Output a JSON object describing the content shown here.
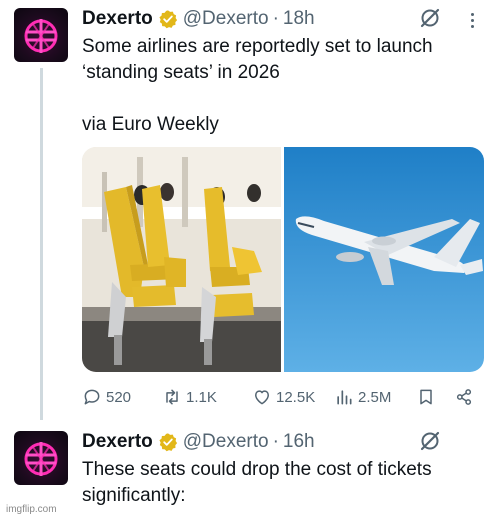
{
  "colors": {
    "text_primary": "#0f1419",
    "text_secondary": "#536471",
    "thread_line": "#cfd9de",
    "verified_badge": "#e2b719",
    "avatar_glow": "#ff2db4"
  },
  "tweets": [
    {
      "author_name": "Dexerto",
      "handle": "@Dexerto",
      "separator": "·",
      "time": "18h",
      "text_lines": [
        "Some airlines are reportedly set to launch",
        "‘standing seats’ in 2026",
        "via Euro Weekly"
      ],
      "media": [
        {
          "icon": "standing-seats-photo"
        },
        {
          "icon": "airplane-photo"
        }
      ],
      "actions": {
        "replies": "520",
        "reposts": "1.1K",
        "likes": "12.5K",
        "views": "2.5M"
      }
    },
    {
      "author_name": "Dexerto",
      "handle": "@Dexerto",
      "separator": "·",
      "time": "16h",
      "text_lines": [
        "These seats could drop the cost of tickets",
        "significantly:"
      ]
    }
  ],
  "icons": {
    "avatar": "dexerto-logo-icon",
    "verified": "verified-badge-icon",
    "grok": "grok-icon",
    "more": "more-dots-icon",
    "reply": "reply-icon",
    "repost": "repost-icon",
    "like": "heart-icon",
    "views": "views-icon",
    "bookmark": "bookmark-icon",
    "share": "share-icon"
  },
  "watermark": "imgflip.com"
}
